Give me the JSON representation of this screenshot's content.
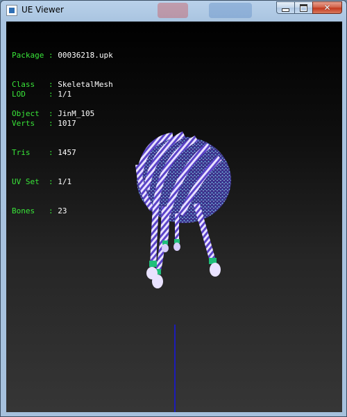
{
  "window": {
    "title": "UE Viewer",
    "buttons": {
      "close_glyph": "✕"
    }
  },
  "info": {
    "general": [
      {
        "label": "Package",
        "sep": ":",
        "value": "00036218.upk"
      },
      {
        "label": "Class  ",
        "sep": ":",
        "value": "SkeletalMesh"
      },
      {
        "label": "Object ",
        "sep": ":",
        "value": "JinM_105"
      }
    ],
    "mesh": [
      {
        "label": "LOD    ",
        "sep": ":",
        "value": "1/1"
      },
      {
        "label": "Verts  ",
        "sep": ":",
        "value": "1017"
      },
      {
        "label": "Tris   ",
        "sep": ":",
        "value": "1457"
      },
      {
        "label": "UV Set ",
        "sep": ":",
        "value": "1/1"
      },
      {
        "label": "Bones  ",
        "sep": ":",
        "value": "23"
      }
    ]
  },
  "colors": {
    "label": "#39e639",
    "value": "#ffffff",
    "mesh_body": "#6a4fd8",
    "mesh_band": "#1fbf7a",
    "axis": "#1c1cb8"
  }
}
